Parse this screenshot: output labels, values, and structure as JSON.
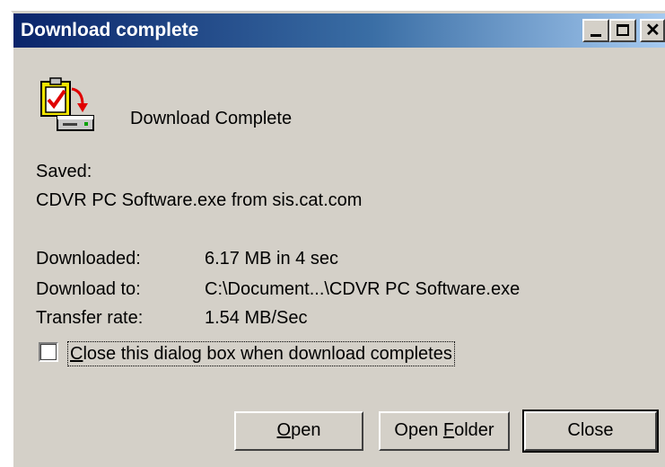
{
  "window": {
    "title": "Download complete",
    "controls": {
      "minimize": "minimize-icon",
      "maximize": "maximize-icon",
      "close": "close-icon"
    },
    "colors": {
      "titlebar_start": "#0a246a",
      "titlebar_end": "#a6caf0",
      "face": "#d4d0c8"
    }
  },
  "header": {
    "icon": "download-complete-icon",
    "message": "Download Complete"
  },
  "saved": {
    "label": "Saved:",
    "value": "CDVR PC Software.exe from sis.cat.com"
  },
  "details": {
    "downloaded_label": "Downloaded:",
    "downloaded_value": "6.17 MB in 4 sec",
    "download_to_label": "Download to:",
    "download_to_value": "C:\\Document...\\CDVR PC Software.exe",
    "transfer_rate_label": "Transfer rate:",
    "transfer_rate_value": "1.54 MB/Sec"
  },
  "option": {
    "checked": false,
    "label_mnemonic": "C",
    "label_rest": "lose this dialog box when download completes"
  },
  "buttons": {
    "open_mnemonic": "O",
    "open_rest": "pen",
    "open_folder_pre": "Open ",
    "open_folder_mnemonic": "F",
    "open_folder_rest": "older",
    "close": "Close"
  }
}
